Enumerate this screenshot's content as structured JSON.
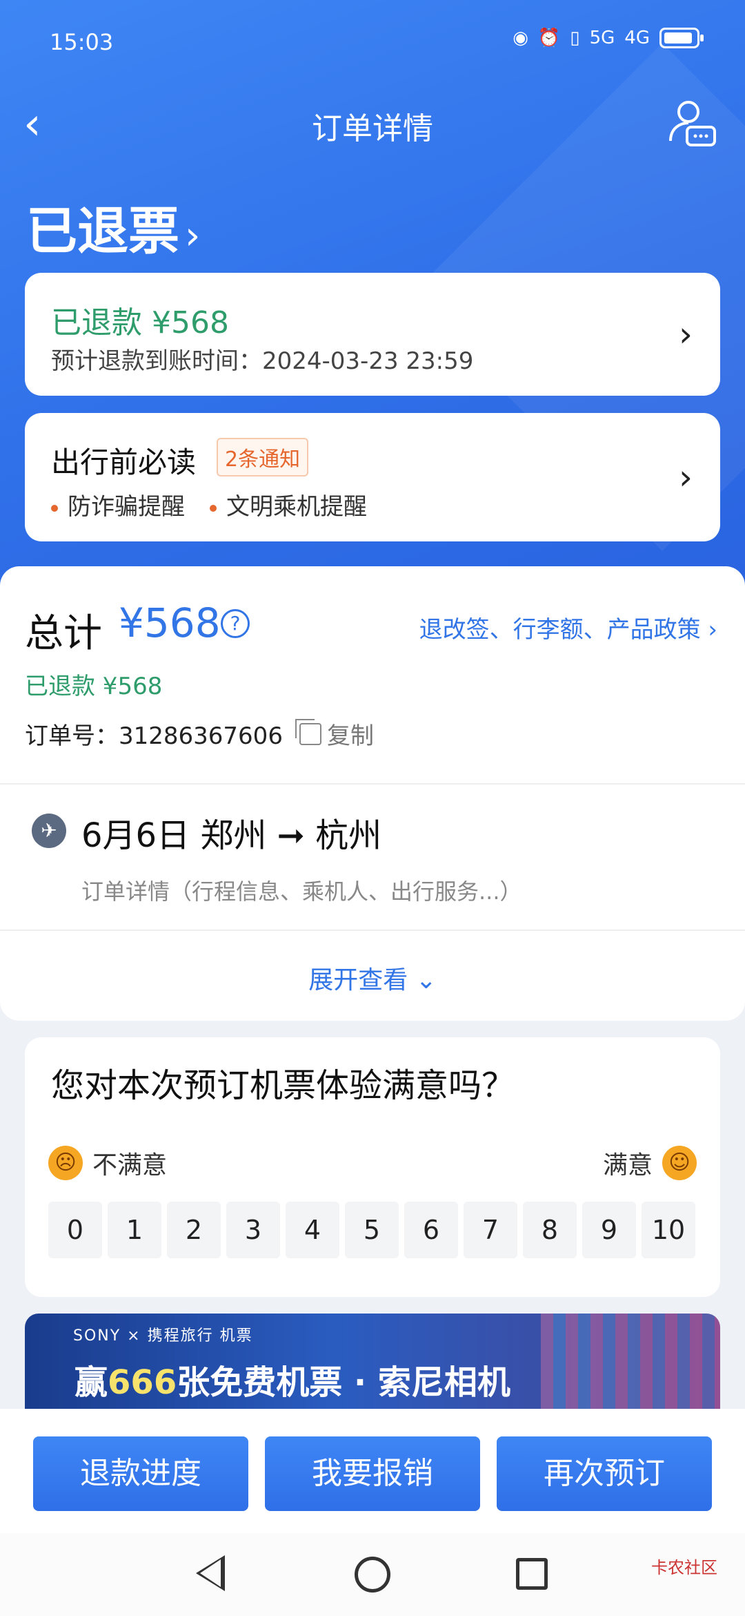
{
  "statusbar": {
    "time": "15:03",
    "network": "5G",
    "network2": "4G"
  },
  "navbar": {
    "title": "订单详情"
  },
  "order_status": {
    "title": "已退票"
  },
  "refund_card": {
    "amount": "已退款 ¥568",
    "time": "预计退款到账时间：2024-03-23 23:59"
  },
  "notice_card": {
    "title": "出行前必读",
    "badge": "2条通知",
    "items": [
      "防诈骗提醒",
      "文明乘机提醒"
    ]
  },
  "order": {
    "total_label": "总计",
    "total_amount": "¥568",
    "policy_link": "退改签、行李额、产品政策 ›",
    "refund_line": "已退款 ¥568",
    "order_no": "订单号：31286367606",
    "copy_label": "复制"
  },
  "trip": {
    "title": "6月6日 郑州 ➞ 杭州",
    "subtitle": "订单详情（行程信息、乘机人、出行服务...）",
    "expand": "展开查看 ⌄"
  },
  "survey": {
    "question": "您对本次预订机票体验满意吗？",
    "unsatisfied": "不满意",
    "satisfied": "满意",
    "scores": [
      "0",
      "1",
      "2",
      "3",
      "4",
      "5",
      "6",
      "7",
      "8",
      "9",
      "10"
    ]
  },
  "banner": {
    "top": "SONY × 携程旅行 机票",
    "main_prefix": "赢",
    "main_highlight": "666",
    "main_suffix": "张免费机票 · 索尼相机"
  },
  "actions": {
    "refund_progress": "退款进度",
    "reimburse": "我要报销",
    "rebook": "再次预订"
  },
  "watermark": "卡农社区"
}
